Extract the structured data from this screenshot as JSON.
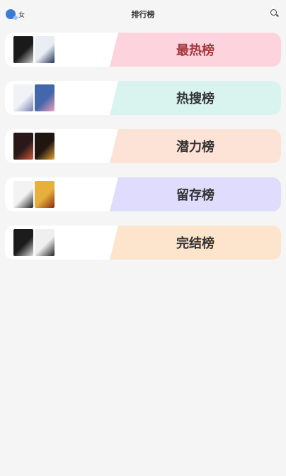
{
  "header": {
    "title": "排行榜",
    "gender_label": "女"
  },
  "rankings": [
    {
      "label": "最热榜",
      "band_color": "#fdd3de",
      "text_color": "#a4373d",
      "covers": [
        {
          "bg": "#1a1a1a",
          "fg": "#cfcfcf"
        },
        {
          "bg": "#e9eef5",
          "fg": "#203050"
        }
      ]
    },
    {
      "label": "热搜榜",
      "band_color": "#d9f4ef",
      "text_color": "#333333",
      "covers": [
        {
          "bg": "#f0f2f6",
          "fg": "#7a7fb3"
        },
        {
          "bg": "#4466aa",
          "fg": "#f0a0c0"
        }
      ]
    },
    {
      "label": "潜力榜",
      "band_color": "#fde2d6",
      "text_color": "#333333",
      "covers": [
        {
          "bg": "#2a1818",
          "fg": "#d45a3a"
        },
        {
          "bg": "#1f1610",
          "fg": "#e8a33a"
        }
      ]
    },
    {
      "label": "留存榜",
      "band_color": "#e0dcfd",
      "text_color": "#333333",
      "covers": [
        {
          "bg": "#f3f3f3",
          "fg": "#222222"
        },
        {
          "bg": "#e6b03a",
          "fg": "#8a2a10"
        }
      ]
    },
    {
      "label": "完结榜",
      "band_color": "#fde4cc",
      "text_color": "#333333",
      "covers": [
        {
          "bg": "#1c1c1c",
          "fg": "#dcdcdc"
        },
        {
          "bg": "#efefef",
          "fg": "#222222"
        }
      ]
    }
  ]
}
